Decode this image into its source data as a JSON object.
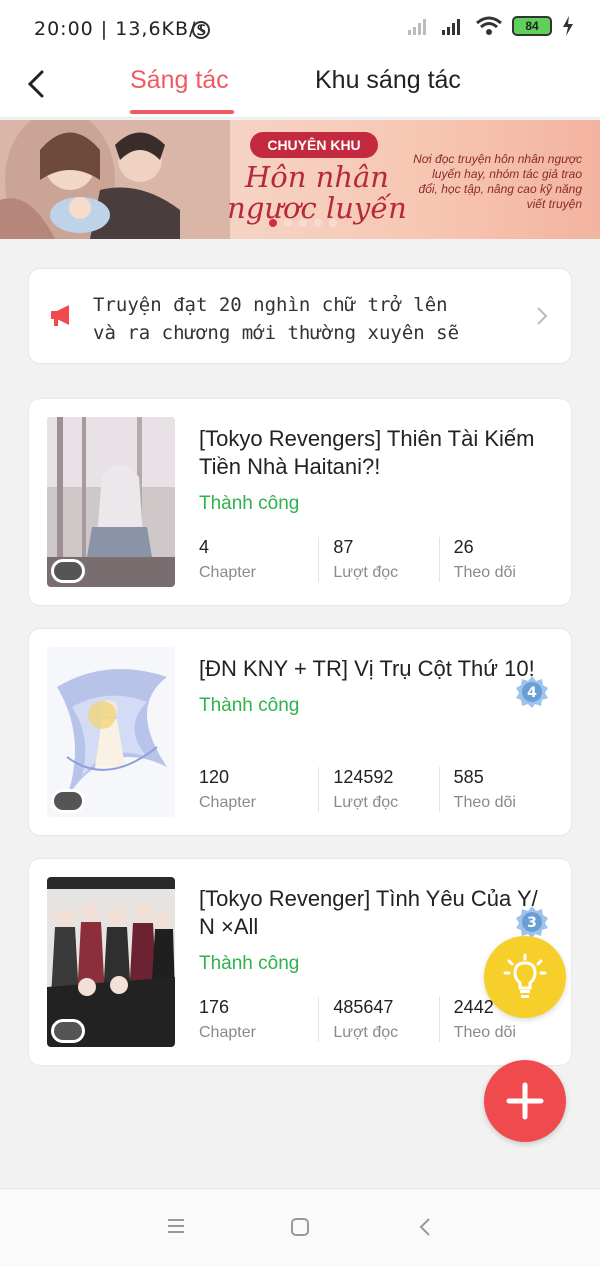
{
  "status_bar": {
    "time": "20:00 | 13,6KB/s",
    "battery": "84",
    "icons": [
      "alarm-icon",
      "signal-icon",
      "wifi-icon",
      "battery-icon",
      "charging-icon"
    ]
  },
  "nav": {
    "tab_active": "Sáng tác",
    "tab_other": "Khu sáng tác",
    "accent": "#ef5a63"
  },
  "banner": {
    "pill": "CHUYÊN KHU",
    "title_line1": "Hôn nhân",
    "title_line2": "ngược luyến",
    "desc": "Nơi đọc truyện hôn nhân ngược luyến hay, nhóm tác giả trao đổi, học tập, nâng cao kỹ năng viết truyện"
  },
  "notice": {
    "text": "Truyện đạt 20 nghìn chữ trở lên\nvà ra chương mới thường xuyên sẽ"
  },
  "works": [
    {
      "title": "[Tokyo Revengers] Thiên Tài Kiếm Tiền Nhà Haitani?!",
      "status": "Thành công",
      "chapters": "4",
      "reads": "87",
      "follows": "26"
    },
    {
      "title": "[ĐN KNY + TR] Vị Trụ Cột Thứ 10!",
      "status": "Thành công",
      "chapters": "120",
      "reads": "124592",
      "follows": "585",
      "badge": "4"
    },
    {
      "title": "[Tokyo Revenger] Tình Yêu Của Y/ N ×All",
      "status": "Thành công",
      "chapters": "176",
      "reads": "485647",
      "follows": "2442",
      "badge": "3"
    }
  ],
  "labels": {
    "chapter": "Chapter",
    "reads": "Lượt đọc",
    "follows": "Theo dõi"
  },
  "colors": {
    "success": "#2fb24a",
    "fab_idea": "#f7cf2a",
    "fab_add": "#ef4b4f"
  }
}
